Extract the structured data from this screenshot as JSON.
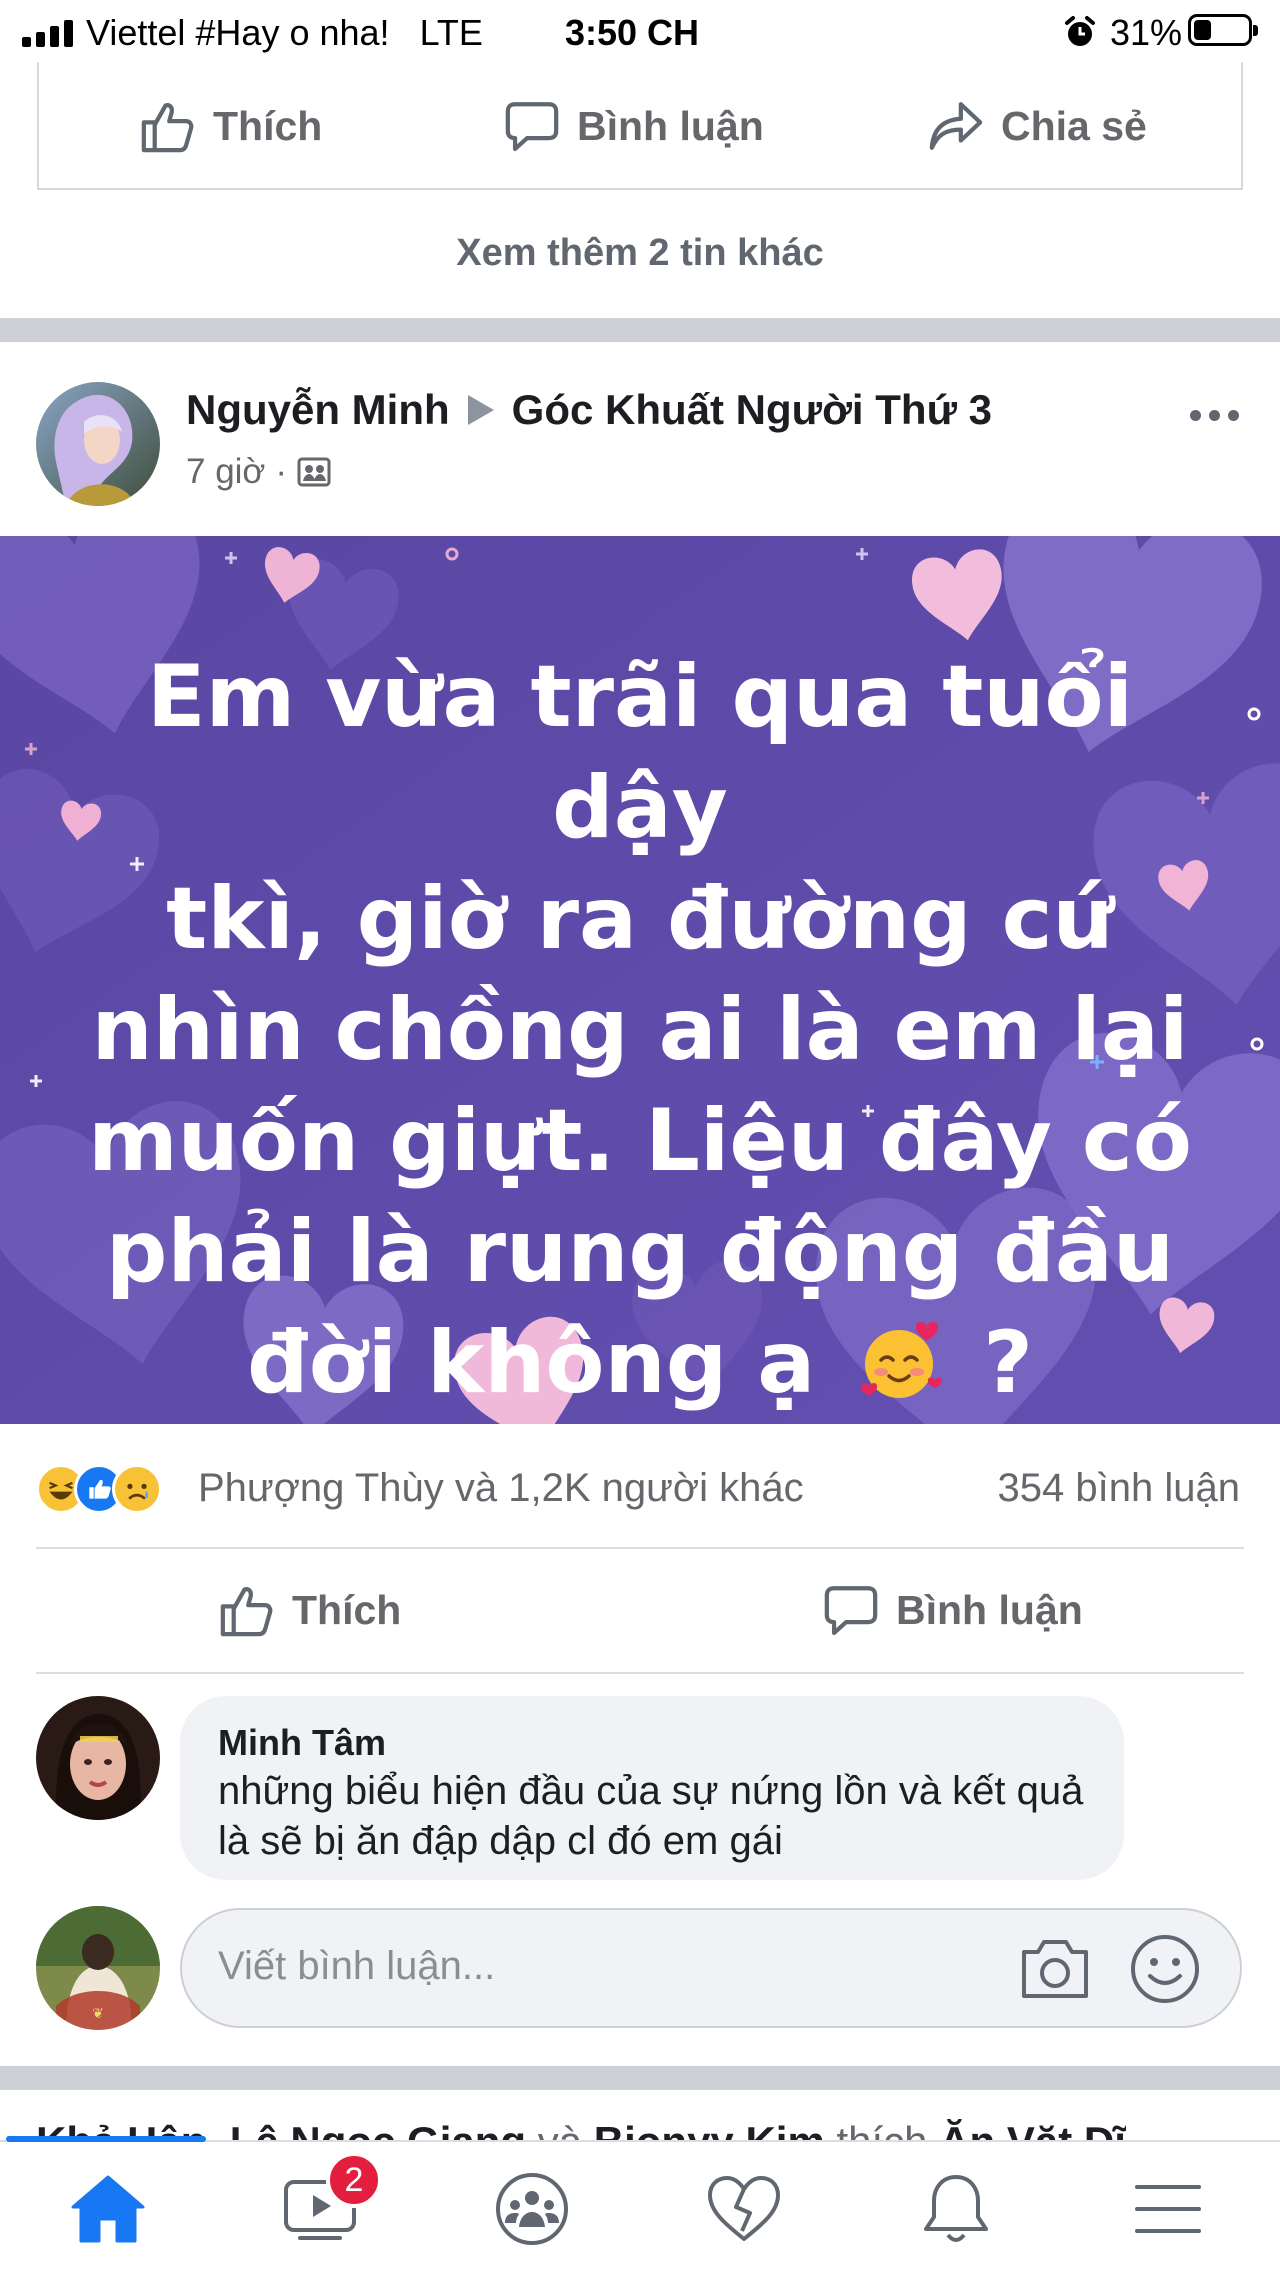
{
  "status_bar": {
    "carrier": "Viettel #Hay o nha!",
    "network": "LTE",
    "time": "3:50 CH",
    "battery": "31%",
    "battery_level": 0.31
  },
  "prev_post": {
    "like_label": "Thích",
    "comment_label": "Bình luận",
    "share_label": "Chia sẻ",
    "see_more": "Xem thêm 2 tin khác"
  },
  "post": {
    "author": "Nguyễn Minh",
    "group": "Góc Khuất Người Thứ 3",
    "time": "7 giờ",
    "audience_icon": "group-icon",
    "card_lines": [
      "Em vừa trãi qua tuổi dậy",
      "tkì, giờ ra đường cứ",
      "nhìn chồng ai là em lại",
      "muốn giựt. Liệu đây có",
      "phải là rung động đầu",
      "đời không ạ"
    ],
    "card_tail": "?",
    "card_emoji": "smiling-face-with-hearts",
    "card_bg": "#5c4aa6",
    "reactions": [
      "haha",
      "like",
      "sad"
    ],
    "reaction_text": "Phượng Thùy và 1,2K người khác",
    "comment_count": "354 bình luận",
    "like_label": "Thích",
    "comment_label": "Bình luận"
  },
  "comment": {
    "name": "Minh Tâm",
    "text": "những biểu hiện đầu của sự nứng lồn và kết quả là sẽ bị ăn đập dập cl đó em gái"
  },
  "composer": {
    "placeholder": "Viết bình luận..."
  },
  "next_post": {
    "names": "Khả Hân, Lê Ngọc Giang",
    "joiner": "và",
    "name3": "Bionyy Kim",
    "action": "thích",
    "page": "Ăn Vặt Dĩ"
  },
  "tabbar": {
    "tabs": [
      "home",
      "watch",
      "groups",
      "dating",
      "notifications",
      "menu"
    ],
    "active": "home",
    "watch_badge": "2",
    "accent": "#1877f2"
  }
}
